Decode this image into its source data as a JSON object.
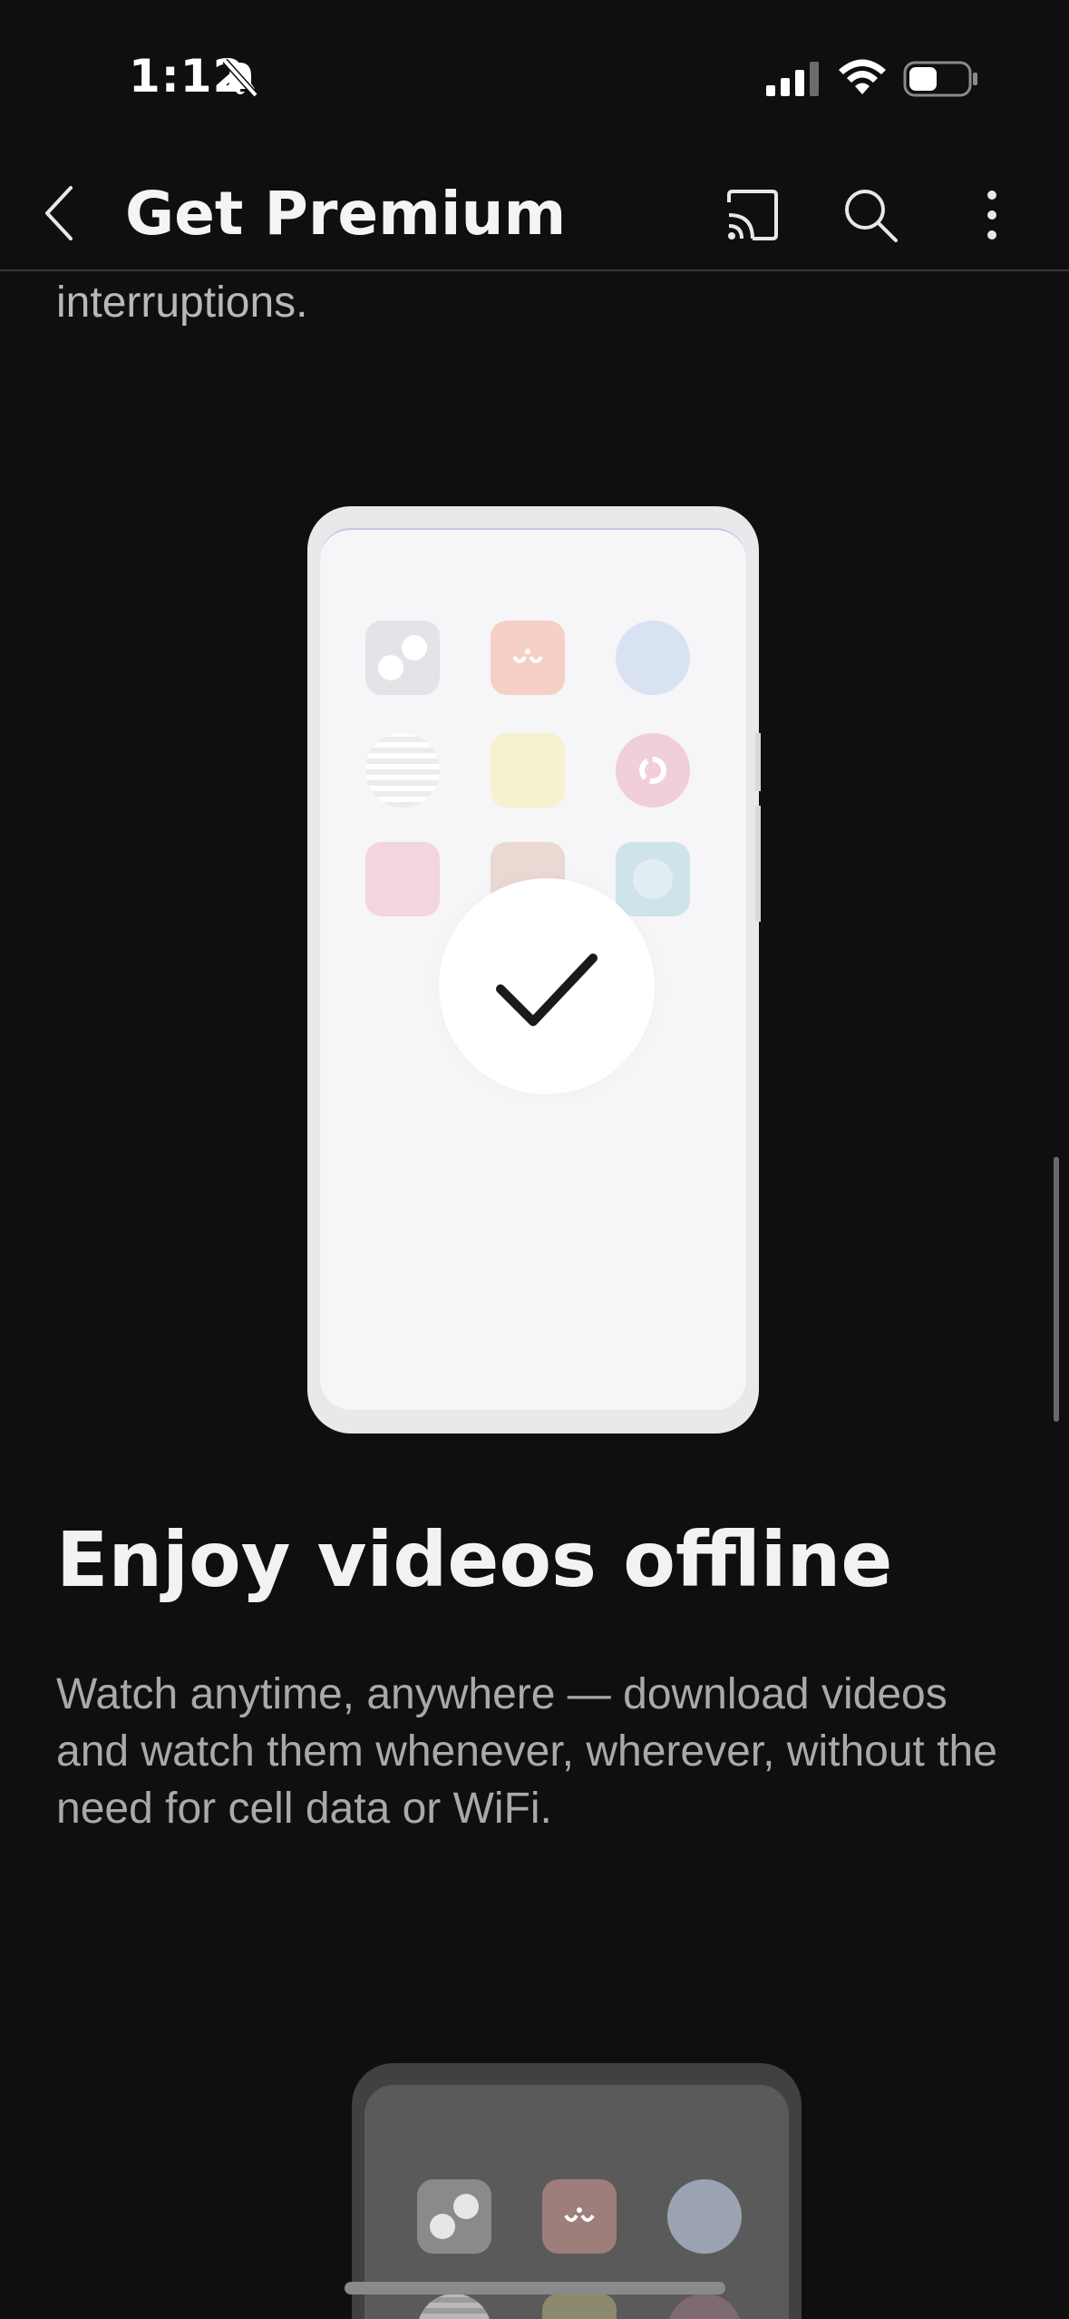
{
  "status_bar": {
    "time": "1:12",
    "icons": [
      "bell-off-icon",
      "signal-icon",
      "wifi-icon",
      "battery-icon"
    ]
  },
  "app_bar": {
    "title": "Get Premium",
    "actions": [
      "cast-icon",
      "search-icon",
      "more-vert-icon"
    ]
  },
  "content": {
    "previous_description_tail": "interruptions.",
    "feature": {
      "title": "Enjoy videos offline",
      "description": "Watch anytime, anywhere — download videos and watch them whenever, wherever, without the need for cell data or WiFi."
    }
  },
  "colors": {
    "background": "#0f0f10",
    "title_text": "#f2f2f2",
    "body_text": "#a9a9a9"
  }
}
